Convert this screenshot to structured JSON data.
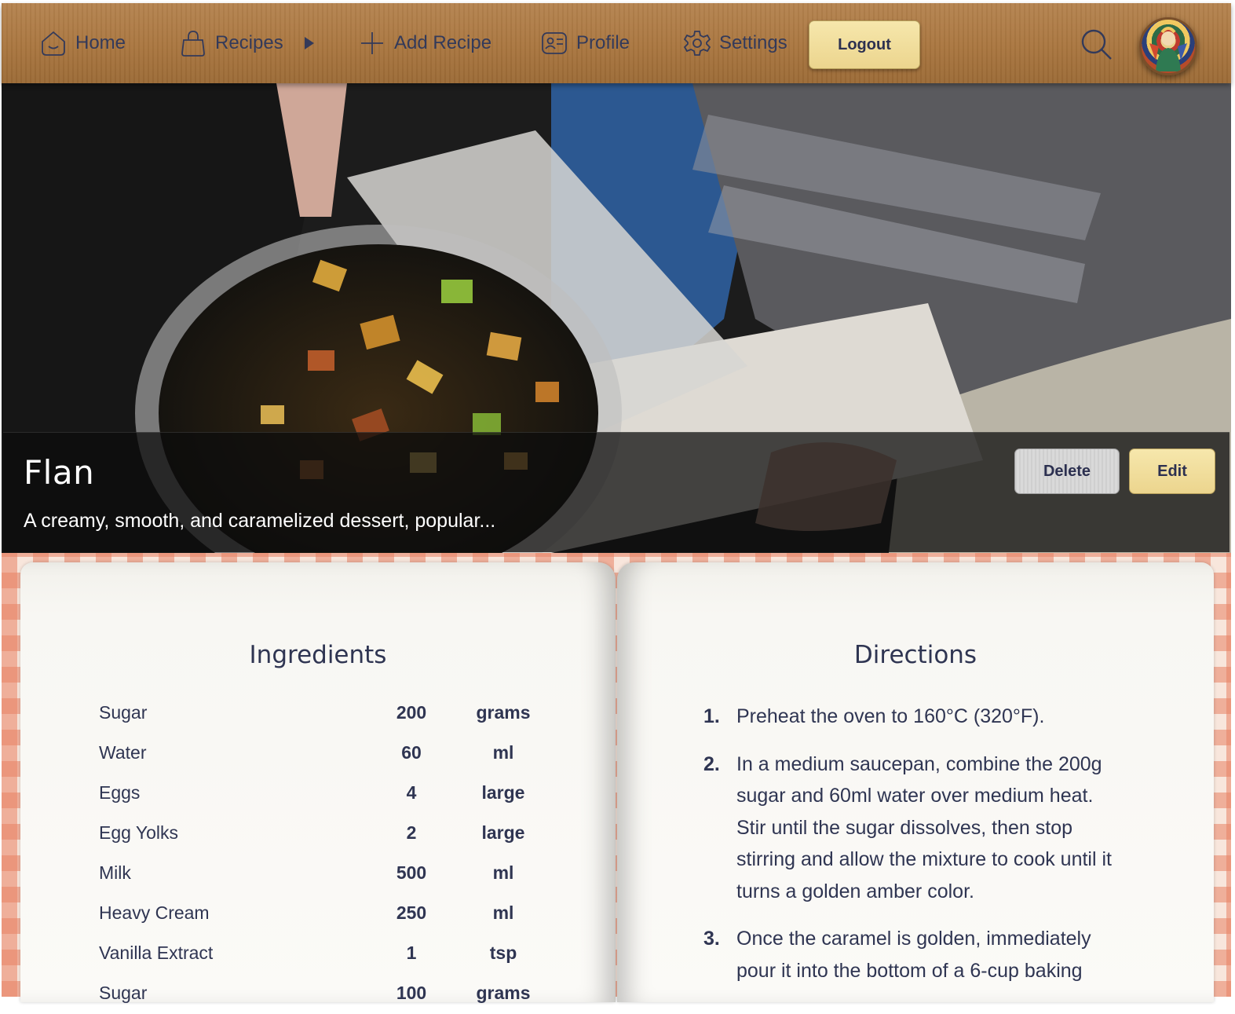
{
  "nav": {
    "home": "Home",
    "recipes": "Recipes",
    "add_recipe": "Add Recipe",
    "profile": "Profile",
    "settings": "Settings",
    "logout": "Logout",
    "search_icon": "search-icon",
    "avatar_icon": "avatar"
  },
  "recipe": {
    "title": "Flan",
    "description": "A creamy, smooth, and caramelized dessert, popular...",
    "delete_label": "Delete",
    "edit_label": "Edit"
  },
  "ingredients": {
    "heading": "Ingredients",
    "items": [
      {
        "name": "Sugar",
        "qty": "200",
        "unit": "grams"
      },
      {
        "name": "Water",
        "qty": "60",
        "unit": "ml"
      },
      {
        "name": "Eggs",
        "qty": "4",
        "unit": "large"
      },
      {
        "name": "Egg Yolks",
        "qty": "2",
        "unit": "large"
      },
      {
        "name": "Milk",
        "qty": "500",
        "unit": "ml"
      },
      {
        "name": "Heavy Cream",
        "qty": "250",
        "unit": "ml"
      },
      {
        "name": "Vanilla Extract",
        "qty": "1",
        "unit": "tsp"
      },
      {
        "name": "Sugar",
        "qty": "100",
        "unit": "grams"
      }
    ]
  },
  "directions": {
    "heading": "Directions",
    "steps": [
      {
        "num": "1.",
        "text": "Preheat the oven to 160°C (320°F)."
      },
      {
        "num": "2.",
        "text": "In a medium saucepan, combine the 200g sugar and 60ml water over medium heat. Stir until the sugar dissolves, then stop stirring and allow the mixture to cook until it turns a golden amber color."
      },
      {
        "num": "3.",
        "text": "Once the caramel is golden, immediately pour it into the bottom of a 6-cup baking"
      }
    ]
  },
  "colors": {
    "nav_wood": "#a9763f",
    "accent_gold": "#ecd58e",
    "text_navy": "#2f3552",
    "cloth_check": "#e88264"
  }
}
